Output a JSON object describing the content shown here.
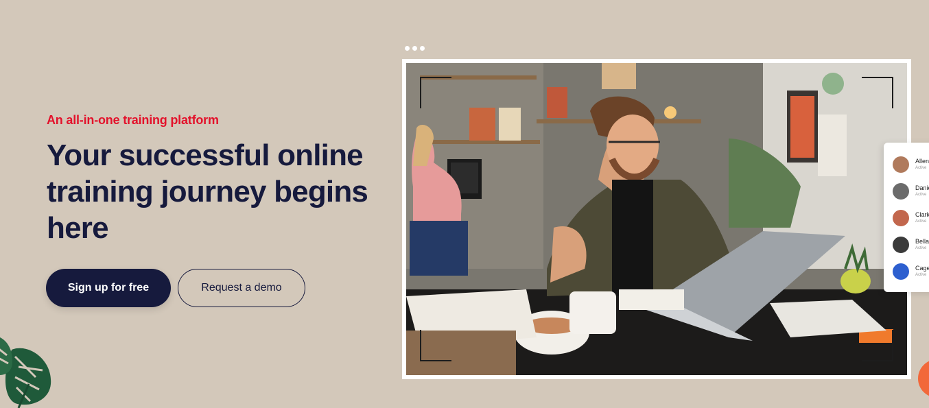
{
  "hero": {
    "eyebrow": "An all-in-one training platform",
    "headline": "Your successful online training journey begins here",
    "primary_cta": "Sign up for free",
    "secondary_cta": "Request a demo"
  },
  "user_list": [
    {
      "name": "Allen",
      "status": "Active",
      "avatar_color": "#b07a5c"
    },
    {
      "name": "Danie",
      "status": "Active",
      "avatar_color": "#6b6b6b"
    },
    {
      "name": "Clark",
      "status": "Active",
      "avatar_color": "#c2674d"
    },
    {
      "name": "Bella",
      "status": "Active",
      "avatar_color": "#3b3b3b"
    },
    {
      "name": "Cage",
      "status": "Active",
      "avatar_color": "#2d5fcf"
    }
  ],
  "colors": {
    "background": "#d3c8ba",
    "accent": "#e3122b",
    "navy": "#161a3d",
    "chat": "#f2683a"
  }
}
